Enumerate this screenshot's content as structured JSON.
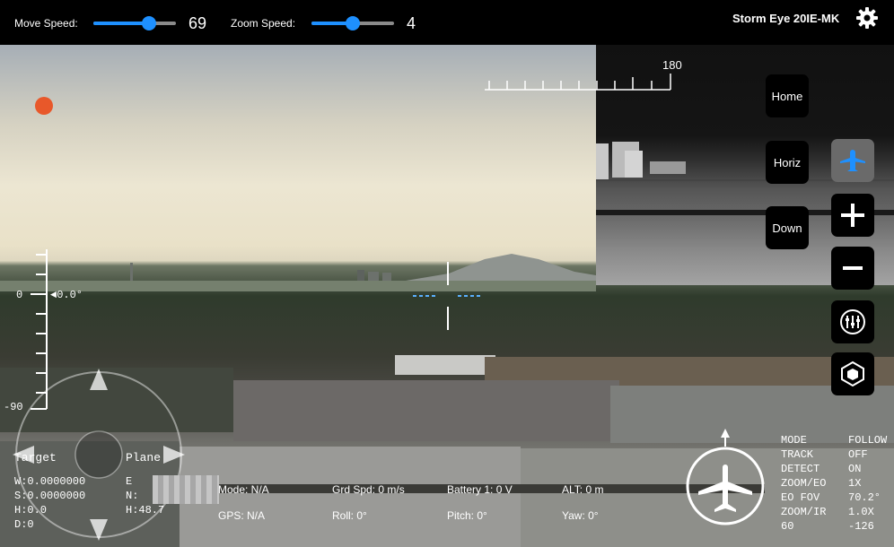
{
  "topbar": {
    "move_speed_label": "Move Speed:",
    "move_speed_value": "69",
    "zoom_speed_label": "Zoom Speed:",
    "zoom_speed_value": "4",
    "device_name": "Storm Eye 20IE-MK",
    "settings_icon": "gear-icon"
  },
  "accent_color": "#1e90ff",
  "recording_color": "#e8582a",
  "controls": {
    "home_label": "Home",
    "horiz_label": "Horiz",
    "down_label": "Down"
  },
  "heading_scale": {
    "value": "180"
  },
  "pitch_scale": {
    "zero_label": "0",
    "pitch_readout": "◄0.0°",
    "minus90_label": "-90"
  },
  "target": {
    "title": "Target",
    "w": "W:0.0000000",
    "s": "S:0.0000000",
    "h": "H:0.0",
    "d": "D:0"
  },
  "plane": {
    "title": "Plane",
    "e": "E",
    "n": "N:",
    "h": "H:48.7"
  },
  "telemetry": {
    "mode": "Mode: N/A",
    "grd_spd": "Grd Spd: 0 m/s",
    "battery": "Battery 1: 0 V",
    "alt": "ALT: 0 m",
    "gps": "GPS: N/A",
    "roll": "Roll: 0°",
    "pitch": "Pitch: 0°",
    "yaw": "Yaw: 0°"
  },
  "status": {
    "rows": [
      {
        "label": "MODE",
        "value": "FOLLOW"
      },
      {
        "label": "TRACK",
        "value": "OFF"
      },
      {
        "label": "DETECT",
        "value": "ON"
      },
      {
        "label": "ZOOM/EO",
        "value": "1X"
      },
      {
        "label": "EO FOV",
        "value": "70.2°"
      },
      {
        "label": "ZOOM/IR",
        "value": "1.0X"
      },
      {
        "label": "60",
        "value": "-126"
      }
    ]
  },
  "icons": {
    "drone_mode": "drone-icon",
    "zoom_in": "plus-icon",
    "zoom_out": "minus-icon",
    "adjust": "sliders-icon",
    "camera_switch": "cube-icon",
    "aircraft": "airplane-icon"
  }
}
